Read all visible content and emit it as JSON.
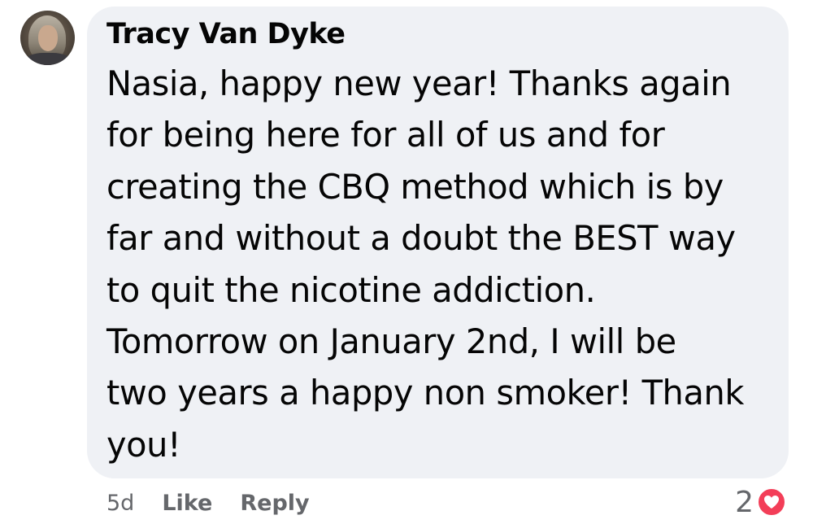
{
  "comment": {
    "author": "Tracy Van Dyke",
    "lines": [
      "Nasia, happy new year! Thanks again",
      "for being here for all of us and for",
      "creating the CBQ method which is by",
      "far and without a doubt the BEST way",
      "to quit the nicotine addiction.",
      "Tomorrow on January 2nd, I will be",
      "two years a happy non smoker! Thank",
      "you!"
    ],
    "timestamp": "5d",
    "like_label": "Like",
    "reply_label": "Reply",
    "reaction_count": "2",
    "reaction_icon": "heart-icon"
  },
  "colors": {
    "bubble_background": "#eff1f5",
    "text": "#050505",
    "secondary_text": "#65676b",
    "heart": "#f33e58"
  }
}
